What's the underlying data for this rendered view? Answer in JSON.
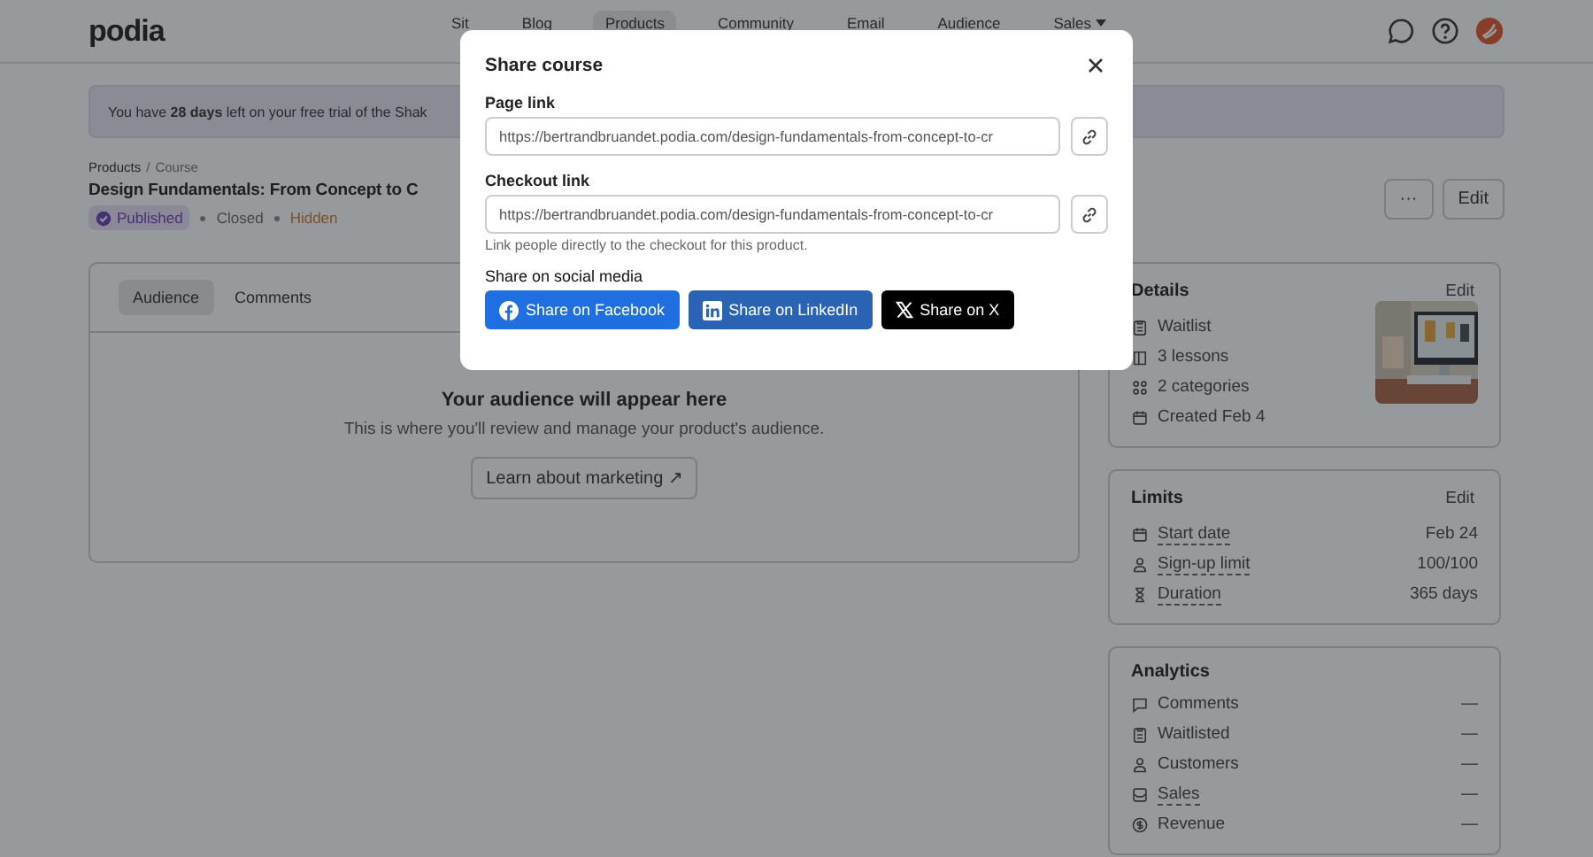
{
  "nav": {
    "logo": "podia",
    "items": [
      {
        "label": "Sit",
        "selected": false
      },
      {
        "label": "Blog",
        "selected": false
      },
      {
        "label": "Products",
        "selected": true
      },
      {
        "label": "Community",
        "selected": false
      },
      {
        "label": "Email",
        "selected": false
      },
      {
        "label": "Audience",
        "selected": false
      },
      {
        "label": "Sales",
        "selected": false,
        "dropdown": true
      }
    ]
  },
  "banner": {
    "text": "You have **28 days** left on your free trial of the Shak"
  },
  "breadcrumb": {
    "items": [
      "Products",
      "Course"
    ],
    "separator": "/"
  },
  "title": "Design Fundamentals: From Concept to C",
  "status": [
    {
      "label": "Published",
      "kind": "badge"
    },
    {
      "label": "Closed",
      "kind": "plain"
    },
    {
      "label": "Hidden",
      "kind": "warning"
    }
  ],
  "header_buttons": [
    "···",
    "Edit"
  ],
  "tabs": [
    {
      "label": "Audience",
      "selected": true
    },
    {
      "label": "Comments",
      "selected": false
    }
  ],
  "empty_state": {
    "title": "Your audience will appear here",
    "text": "This is where you'll review and manage your product's audience.",
    "button": "Learn about marketing ↗"
  },
  "details": {
    "title": "Details",
    "edit": "Edit",
    "rows": [
      {
        "kind": "clipboard",
        "label": "Waitlist"
      },
      {
        "kind": "book",
        "label": "3 lessons"
      },
      {
        "kind": "grid",
        "label": "2 categories"
      },
      {
        "kind": "calendar",
        "label": "Created Feb 4"
      }
    ]
  },
  "limits": {
    "title": "Limits",
    "edit": "Edit",
    "rows": [
      {
        "kind": "calendar",
        "label": "Start date",
        "value": "Feb 24",
        "underlined": true
      },
      {
        "kind": "person",
        "label": "Sign-up limit",
        "value": "100/100",
        "underlined": true
      },
      {
        "kind": "hourglass",
        "label": "Duration",
        "value": "365 days",
        "underlined": true
      }
    ]
  },
  "analytics": {
    "title": "Analytics",
    "rows": [
      {
        "kind": "chat",
        "label": "Comments",
        "value": "—",
        "underlined": false
      },
      {
        "kind": "clipboard",
        "label": "Waitlisted",
        "value": "—",
        "underlined": false
      },
      {
        "kind": "person",
        "label": "Customers",
        "value": "—",
        "underlined": false
      },
      {
        "kind": "inbox",
        "label": "Sales",
        "value": "—",
        "underlined": true
      },
      {
        "kind": "dollar",
        "label": "Revenue",
        "value": "—",
        "underlined": false
      }
    ]
  },
  "modal": {
    "title": "Share course",
    "fields": [
      {
        "label": "Page link",
        "value": "https://bertrandbruandet.podia.com/design-fundamentals-from-concept-to-cr"
      },
      {
        "label": "Checkout link",
        "value": "https://bertrandbruandet.podia.com/design-fundamentals-from-concept-to-cr",
        "hint": "Link people directly to the checkout for this product."
      }
    ],
    "social_title": "Share on social media",
    "social": [
      {
        "kind": "facebook",
        "label": "Share on Facebook"
      },
      {
        "kind": "linkedin",
        "label": "Share on LinkedIn"
      },
      {
        "kind": "x",
        "label": "Share on X"
      }
    ]
  }
}
